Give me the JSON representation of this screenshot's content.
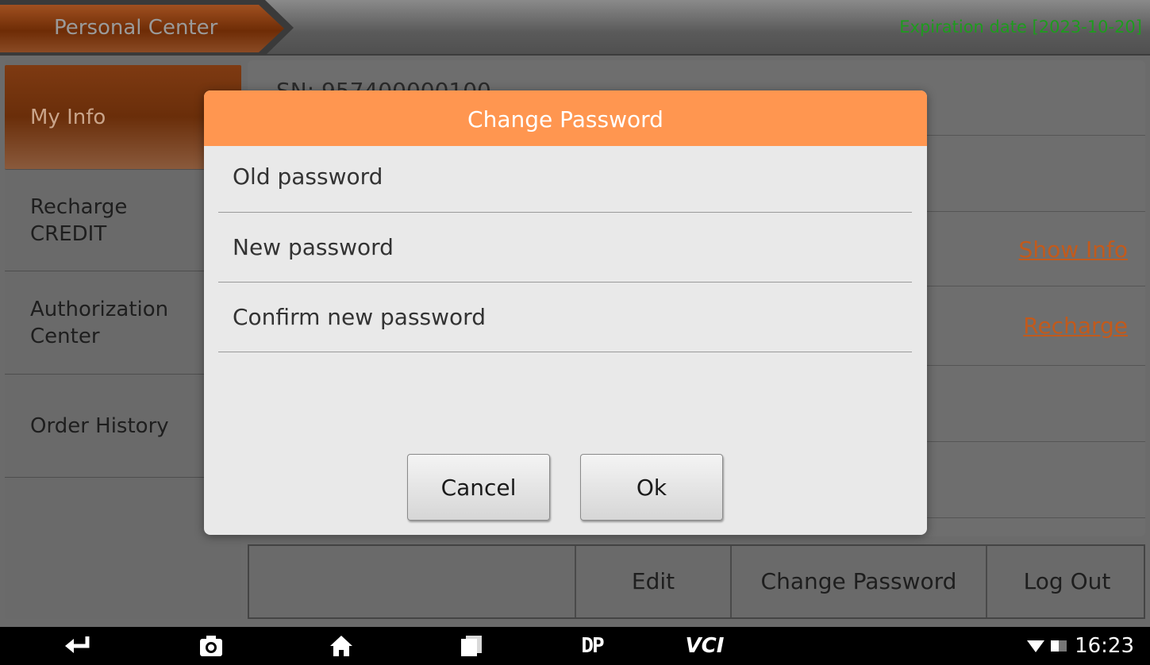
{
  "header": {
    "title": "Personal Center",
    "expiration": "Expiration date [2023-10-20]"
  },
  "sidebar": {
    "items": [
      {
        "label": "My Info",
        "selected": true
      },
      {
        "label": "Recharge\nCREDIT",
        "selected": false
      },
      {
        "label": "Authorization\nCenter",
        "selected": false
      },
      {
        "label": "Order History",
        "selected": false
      }
    ]
  },
  "content": {
    "sn_partial": "SN: 957400000100",
    "show_info_link": "Show Info",
    "recharge_link": "Recharge"
  },
  "actions": {
    "edit": "Edit",
    "change_password": "Change Password",
    "log_out": "Log Out"
  },
  "dialog": {
    "title": "Change Password",
    "old_placeholder": "Old password",
    "new_placeholder": "New password",
    "confirm_placeholder": "Confirm new password",
    "cancel_label": "Cancel",
    "ok_label": "Ok"
  },
  "navbar": {
    "dp_label": "DP",
    "vci_label": "VCI",
    "time": "16:23"
  },
  "colors": {
    "accent": "#ff9650",
    "link": "#c25a1c",
    "expiration": "#1e9b1e",
    "selected_tab": "#7e3a12"
  }
}
